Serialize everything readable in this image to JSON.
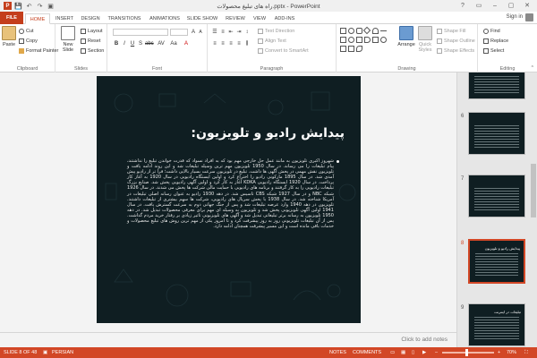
{
  "window": {
    "title": "راه های تبلیغ محصولات.pptx - PowerPoint",
    "qat": {
      "app_icon": "P",
      "save": "💾",
      "undo": "↶",
      "redo": "↷",
      "present": "▣"
    }
  },
  "ribbon": {
    "tabs": [
      {
        "label": "FILE"
      },
      {
        "label": "HOME"
      },
      {
        "label": "INSERT"
      },
      {
        "label": "DESIGN"
      },
      {
        "label": "TRANSITIONS"
      },
      {
        "label": "ANIMATIONS"
      },
      {
        "label": "SLIDE SHOW"
      },
      {
        "label": "REVIEW"
      },
      {
        "label": "VIEW"
      },
      {
        "label": "ADD-INS"
      }
    ],
    "sign_in": "Sign in",
    "clipboard": {
      "label": "Clipboard",
      "paste": "Paste",
      "cut": "Cut",
      "copy": "Copy",
      "format_painter": "Format Painter"
    },
    "slides": {
      "label": "Slides",
      "new_slide": "New Slide",
      "layout": "Layout",
      "reset": "Reset",
      "section": "Section"
    },
    "font": {
      "label": "Font"
    },
    "paragraph": {
      "label": "Paragraph",
      "text_direction": "Text Direction",
      "align_text": "Align Text",
      "convert_smartart": "Convert to SmartArt"
    },
    "drawing": {
      "label": "Drawing",
      "arrange": "Arrange",
      "quick_styles": "Quick Styles",
      "shape_fill": "Shape Fill",
      "shape_outline": "Shape Outline",
      "shape_effects": "Shape Effects"
    },
    "editing": {
      "label": "Editing",
      "find": "Find",
      "replace": "Replace",
      "select": "Select"
    }
  },
  "slide": {
    "title": "پیدایش رادیو و تلویزیون:",
    "body": "شهروز اکبری تلویزیون به مانند عمل حل خارجی مهم بود که به افراد نسواد که قدرت خواندن تبلیغ را نداشتند، پیام تبلیغات را می رساند. در سال 1950 تلویزیون مهم ترین وسیله تبلیغات شد و این روند ادامه یافت و تلویزیون نقش مهمی در پخش آگهی ها داشت. تبلیغ در تلویزیون سرعت بسیار بالایی داشت؛ فرا تر از رادیو پیش آمدی شد. در سال 1895 مارکونی رادیو را اختراع کرد و اولین ایستگاه رادیویی در سال 1920 به آغاز کار پرداخت. در سال 1920 ایستگاه رادیویی KDKA آغاز به کار کرد و اولین آگهی رادیویی پخش شد. صنایع بزرگ تبلیغات رادیویی را به کار گرفتند و برنامه های رادیویی با حمایت مالی شرکت ها پخش می شدند. در سال 1926 شبکه NBC و در سال 1927 شبکه CBS تاسیس شد. در دهه 1930 رادیو به عنوان رسانه اصلی تبلیغات در آمریکا شناخته شد. در سال 1938 با پخش سریال های رادیویی، شرکت ها سهم بیشتری از تبلیغات داشتند. تلویزیون در دهه 1940 وارد عرصه تبلیغات شد و پس از جنگ جهانی دوم به سرعت گسترش یافت. در سال 1941 اولین آگهی تلویزیونی پخش شد و تلویزیون به وسیله ای مهم برای معرفی محصولات تبدیل شد. در دهه 1950 تلویزیون به رسانه برتر تبلیغاتی تبدیل شد و آگهی های تلویزیونی تاثیر زیادی بر رفتار خرید مردم گذاشت. پس از آن تبلیغات تلویزیونی روز به روز پیشرفت کرد و تا امروز یکی از مهم ترین روش های تبلیغ محصولات و خدمات باقی مانده است و این مسیر پیشرفت همچنان ادامه دارد."
  },
  "notes": {
    "placeholder": "Click to add notes"
  },
  "thumbnails": [
    {
      "num": "6",
      "title": "",
      "active": false
    },
    {
      "num": "7",
      "title": "",
      "active": false
    },
    {
      "num": "8",
      "title": "پیدایش رادیو و تلویزیون",
      "active": true
    },
    {
      "num": "9",
      "title": "تبلیغات در اینترنت",
      "active": false
    }
  ],
  "status": {
    "slide_of": "SLIDE 8 OF 48",
    "language": "PERSIAN",
    "notes": "NOTES",
    "comments": "COMMENTS",
    "zoom": "70%"
  },
  "colors": {
    "accent": "#d24726",
    "file_tab": "#c43e1c",
    "slide_bg": "#0f1e22"
  }
}
